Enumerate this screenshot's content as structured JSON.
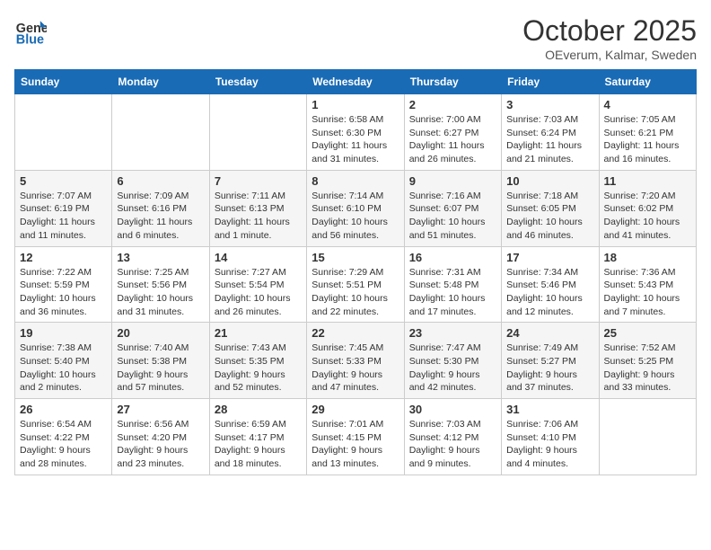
{
  "logo": {
    "general": "General",
    "blue": "Blue"
  },
  "title": "October 2025",
  "subtitle": "OEverum, Kalmar, Sweden",
  "days_of_week": [
    "Sunday",
    "Monday",
    "Tuesday",
    "Wednesday",
    "Thursday",
    "Friday",
    "Saturday"
  ],
  "weeks": [
    [
      {
        "day": "",
        "text": ""
      },
      {
        "day": "",
        "text": ""
      },
      {
        "day": "",
        "text": ""
      },
      {
        "day": "1",
        "text": "Sunrise: 6:58 AM\nSunset: 6:30 PM\nDaylight: 11 hours\nand 31 minutes."
      },
      {
        "day": "2",
        "text": "Sunrise: 7:00 AM\nSunset: 6:27 PM\nDaylight: 11 hours\nand 26 minutes."
      },
      {
        "day": "3",
        "text": "Sunrise: 7:03 AM\nSunset: 6:24 PM\nDaylight: 11 hours\nand 21 minutes."
      },
      {
        "day": "4",
        "text": "Sunrise: 7:05 AM\nSunset: 6:21 PM\nDaylight: 11 hours\nand 16 minutes."
      }
    ],
    [
      {
        "day": "5",
        "text": "Sunrise: 7:07 AM\nSunset: 6:19 PM\nDaylight: 11 hours\nand 11 minutes."
      },
      {
        "day": "6",
        "text": "Sunrise: 7:09 AM\nSunset: 6:16 PM\nDaylight: 11 hours\nand 6 minutes."
      },
      {
        "day": "7",
        "text": "Sunrise: 7:11 AM\nSunset: 6:13 PM\nDaylight: 11 hours\nand 1 minute."
      },
      {
        "day": "8",
        "text": "Sunrise: 7:14 AM\nSunset: 6:10 PM\nDaylight: 10 hours\nand 56 minutes."
      },
      {
        "day": "9",
        "text": "Sunrise: 7:16 AM\nSunset: 6:07 PM\nDaylight: 10 hours\nand 51 minutes."
      },
      {
        "day": "10",
        "text": "Sunrise: 7:18 AM\nSunset: 6:05 PM\nDaylight: 10 hours\nand 46 minutes."
      },
      {
        "day": "11",
        "text": "Sunrise: 7:20 AM\nSunset: 6:02 PM\nDaylight: 10 hours\nand 41 minutes."
      }
    ],
    [
      {
        "day": "12",
        "text": "Sunrise: 7:22 AM\nSunset: 5:59 PM\nDaylight: 10 hours\nand 36 minutes."
      },
      {
        "day": "13",
        "text": "Sunrise: 7:25 AM\nSunset: 5:56 PM\nDaylight: 10 hours\nand 31 minutes."
      },
      {
        "day": "14",
        "text": "Sunrise: 7:27 AM\nSunset: 5:54 PM\nDaylight: 10 hours\nand 26 minutes."
      },
      {
        "day": "15",
        "text": "Sunrise: 7:29 AM\nSunset: 5:51 PM\nDaylight: 10 hours\nand 22 minutes."
      },
      {
        "day": "16",
        "text": "Sunrise: 7:31 AM\nSunset: 5:48 PM\nDaylight: 10 hours\nand 17 minutes."
      },
      {
        "day": "17",
        "text": "Sunrise: 7:34 AM\nSunset: 5:46 PM\nDaylight: 10 hours\nand 12 minutes."
      },
      {
        "day": "18",
        "text": "Sunrise: 7:36 AM\nSunset: 5:43 PM\nDaylight: 10 hours\nand 7 minutes."
      }
    ],
    [
      {
        "day": "19",
        "text": "Sunrise: 7:38 AM\nSunset: 5:40 PM\nDaylight: 10 hours\nand 2 minutes."
      },
      {
        "day": "20",
        "text": "Sunrise: 7:40 AM\nSunset: 5:38 PM\nDaylight: 9 hours\nand 57 minutes."
      },
      {
        "day": "21",
        "text": "Sunrise: 7:43 AM\nSunset: 5:35 PM\nDaylight: 9 hours\nand 52 minutes."
      },
      {
        "day": "22",
        "text": "Sunrise: 7:45 AM\nSunset: 5:33 PM\nDaylight: 9 hours\nand 47 minutes."
      },
      {
        "day": "23",
        "text": "Sunrise: 7:47 AM\nSunset: 5:30 PM\nDaylight: 9 hours\nand 42 minutes."
      },
      {
        "day": "24",
        "text": "Sunrise: 7:49 AM\nSunset: 5:27 PM\nDaylight: 9 hours\nand 37 minutes."
      },
      {
        "day": "25",
        "text": "Sunrise: 7:52 AM\nSunset: 5:25 PM\nDaylight: 9 hours\nand 33 minutes."
      }
    ],
    [
      {
        "day": "26",
        "text": "Sunrise: 6:54 AM\nSunset: 4:22 PM\nDaylight: 9 hours\nand 28 minutes."
      },
      {
        "day": "27",
        "text": "Sunrise: 6:56 AM\nSunset: 4:20 PM\nDaylight: 9 hours\nand 23 minutes."
      },
      {
        "day": "28",
        "text": "Sunrise: 6:59 AM\nSunset: 4:17 PM\nDaylight: 9 hours\nand 18 minutes."
      },
      {
        "day": "29",
        "text": "Sunrise: 7:01 AM\nSunset: 4:15 PM\nDaylight: 9 hours\nand 13 minutes."
      },
      {
        "day": "30",
        "text": "Sunrise: 7:03 AM\nSunset: 4:12 PM\nDaylight: 9 hours\nand 9 minutes."
      },
      {
        "day": "31",
        "text": "Sunrise: 7:06 AM\nSunset: 4:10 PM\nDaylight: 9 hours\nand 4 minutes."
      },
      {
        "day": "",
        "text": ""
      }
    ]
  ]
}
